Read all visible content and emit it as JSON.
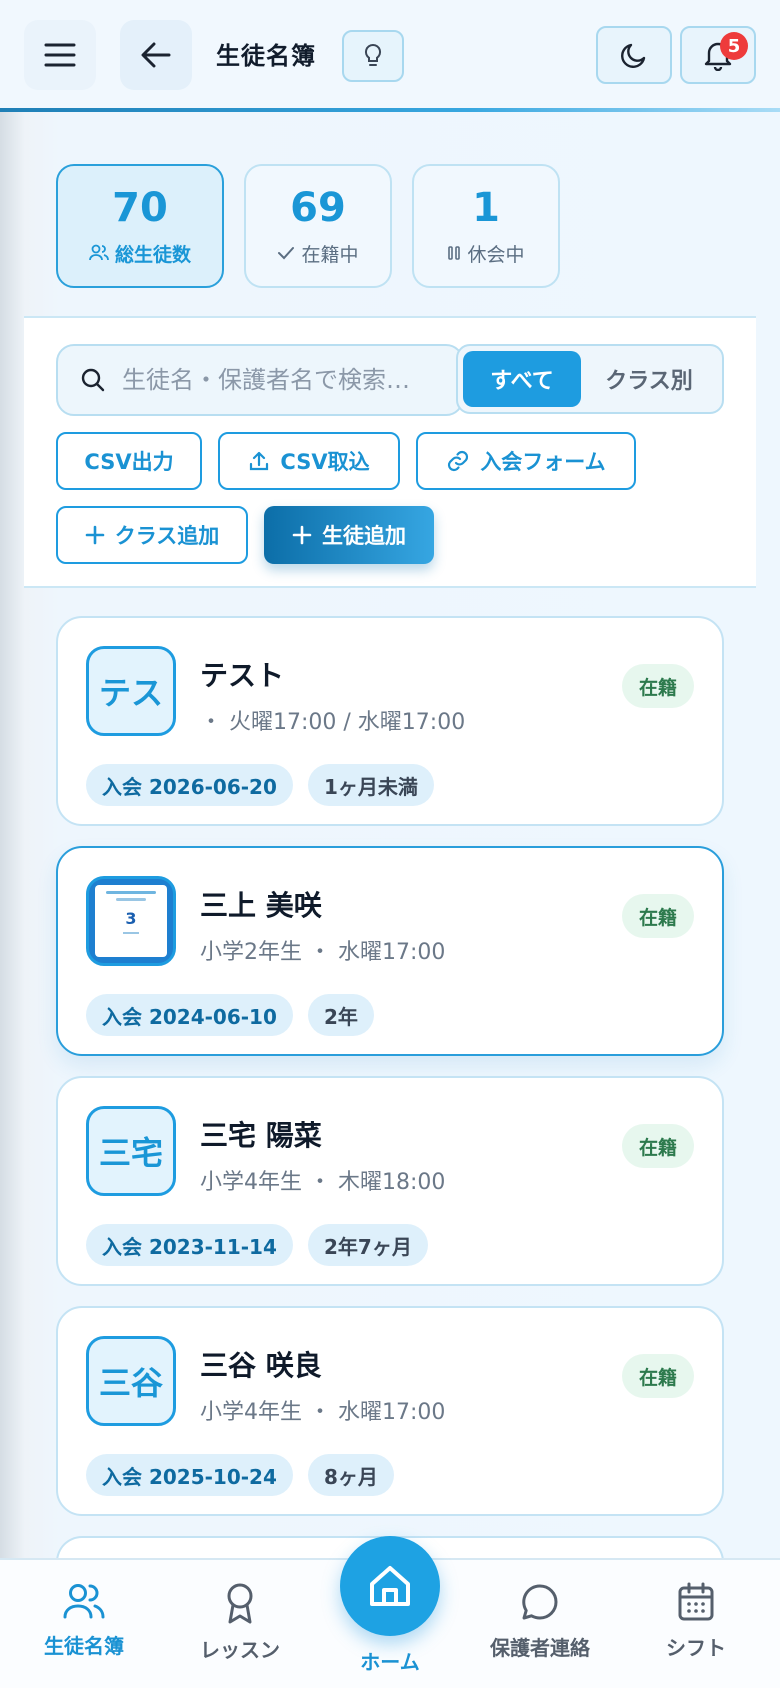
{
  "header": {
    "title": "生徒名簿",
    "notification_count": "5"
  },
  "stats": [
    {
      "value": "70",
      "label": "総生徒数",
      "active": true
    },
    {
      "value": "69",
      "label": "在籍中"
    },
    {
      "value": "1",
      "label": "休会中"
    }
  ],
  "toolbar": {
    "search_placeholder": "生徒名・保護者名で検索…",
    "view_all": "すべて",
    "view_by_class": "クラス別",
    "csv_export": "CSV出力",
    "csv_import": "CSV取込",
    "join_form": "入会フォーム",
    "add_class": "クラス追加",
    "add_student": "生徒追加"
  },
  "students": [
    {
      "avatar": "テス",
      "name": "テスト",
      "meta": "・ 火曜17:00 / 水曜17:00",
      "status": "在籍",
      "joined": "入会 2026-06-20",
      "tenure": "1ヶ月未満"
    },
    {
      "avatar": "3",
      "name": "三上 美咲",
      "meta": "小学2年生 ・ 水曜17:00",
      "status": "在籍",
      "joined": "入会 2024-06-10",
      "tenure": "2年"
    },
    {
      "avatar": "三宅",
      "name": "三宅 陽菜",
      "meta": "小学4年生 ・ 木曜18:00",
      "status": "在籍",
      "joined": "入会 2023-11-14",
      "tenure": "2年7ヶ月"
    },
    {
      "avatar": "三谷",
      "name": "三谷 咲良",
      "meta": "小学4年生 ・ 水曜17:00",
      "status": "在籍",
      "joined": "入会 2025-10-24",
      "tenure": "8ヶ月"
    }
  ],
  "nav": {
    "students": "生徒名簿",
    "lessons": "レッスン",
    "home": "ホーム",
    "parents": "保護者連絡",
    "shifts": "シフト"
  },
  "colors": {
    "accent": "#1e9ce0",
    "status_bg": "#e7f7ee",
    "status_text": "#2d7a4d",
    "badge": "#ee3b3b"
  }
}
